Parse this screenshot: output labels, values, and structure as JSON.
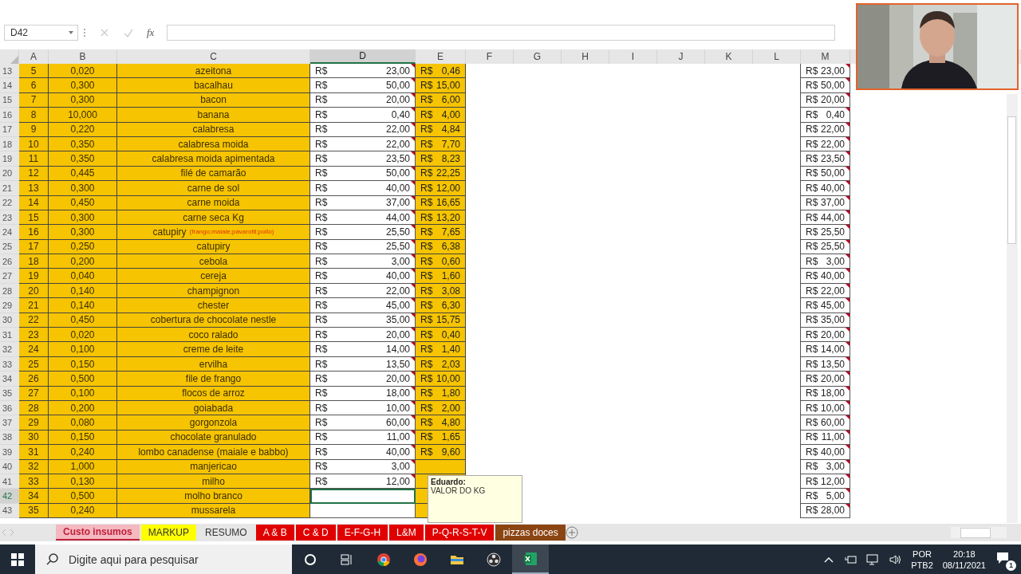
{
  "formula_bar": {
    "name_box": "D42",
    "fx": "fx"
  },
  "columns": [
    {
      "label": "A",
      "selected": false
    },
    {
      "label": "B",
      "selected": false
    },
    {
      "label": "C",
      "selected": false
    },
    {
      "label": "D",
      "selected": true
    },
    {
      "label": "E",
      "selected": false
    },
    {
      "label": "F",
      "selected": false
    },
    {
      "label": "G",
      "selected": false
    },
    {
      "label": "H",
      "selected": false
    },
    {
      "label": "I",
      "selected": false
    },
    {
      "label": "J",
      "selected": false
    },
    {
      "label": "K",
      "selected": false
    },
    {
      "label": "L",
      "selected": false
    },
    {
      "label": "M",
      "selected": false
    }
  ],
  "rows": [
    {
      "row": "13",
      "a": "5",
      "b": "0,020",
      "c": "azeitona",
      "d_cur": "R$",
      "d": "23,00",
      "e_cur": "R$",
      "e": "0,46",
      "m_cur": "R$",
      "m": "23,00",
      "selected": false
    },
    {
      "row": "14",
      "a": "6",
      "b": "0,300",
      "c": "bacalhau",
      "d_cur": "R$",
      "d": "50,00",
      "e_cur": "R$",
      "e": "15,00",
      "m_cur": "R$",
      "m": "50,00",
      "selected": false
    },
    {
      "row": "15",
      "a": "7",
      "b": "0,300",
      "c": "bacon",
      "d_cur": "R$",
      "d": "20,00",
      "e_cur": "R$",
      "e": "6,00",
      "m_cur": "R$",
      "m": "20,00",
      "selected": false
    },
    {
      "row": "16",
      "a": "8",
      "b": "10,000",
      "c": "banana",
      "d_cur": "R$",
      "d": "0,40",
      "e_cur": "R$",
      "e": "4,00",
      "m_cur": "R$",
      "m": "0,40",
      "selected": false
    },
    {
      "row": "17",
      "a": "9",
      "b": "0,220",
      "c": "calabresa",
      "d_cur": "R$",
      "d": "22,00",
      "e_cur": "R$",
      "e": "4,84",
      "m_cur": "R$",
      "m": "22,00",
      "selected": false
    },
    {
      "row": "18",
      "a": "10",
      "b": "0,350",
      "c": "calabresa moida",
      "d_cur": "R$",
      "d": "22,00",
      "e_cur": "R$",
      "e": "7,70",
      "m_cur": "R$",
      "m": "22,00",
      "selected": false
    },
    {
      "row": "19",
      "a": "11",
      "b": "0,350",
      "c": "calabresa moida apimentada",
      "d_cur": "R$",
      "d": "23,50",
      "e_cur": "R$",
      "e": "8,23",
      "m_cur": "R$",
      "m": "23,50",
      "selected": false
    },
    {
      "row": "20",
      "a": "12",
      "b": "0,445",
      "c": "filé de camarão",
      "d_cur": "R$",
      "d": "50,00",
      "e_cur": "R$",
      "e": "22,25",
      "m_cur": "R$",
      "m": "50,00",
      "selected": false
    },
    {
      "row": "21",
      "a": "13",
      "b": "0,300",
      "c": "carne de sol",
      "d_cur": "R$",
      "d": "40,00",
      "e_cur": "R$",
      "e": "12,00",
      "m_cur": "R$",
      "m": "40,00",
      "selected": false
    },
    {
      "row": "22",
      "a": "14",
      "b": "0,450",
      "c": "carne moida",
      "d_cur": "R$",
      "d": "37,00",
      "e_cur": "R$",
      "e": "16,65",
      "m_cur": "R$",
      "m": "37,00",
      "selected": false
    },
    {
      "row": "23",
      "a": "15",
      "b": "0,300",
      "c": "carne seca Kg",
      "d_cur": "R$",
      "d": "44,00",
      "e_cur": "R$",
      "e": "13,20",
      "m_cur": "R$",
      "m": "44,00",
      "selected": false
    },
    {
      "row": "24",
      "a": "16",
      "b": "0,300",
      "c": "catupiry",
      "c_note": "(frango;maiale;pavarotti;pollo)",
      "d_cur": "R$",
      "d": "25,50",
      "e_cur": "R$",
      "e": "7,65",
      "m_cur": "R$",
      "m": "25,50",
      "selected": false
    },
    {
      "row": "25",
      "a": "17",
      "b": "0,250",
      "c": "catupiry",
      "d_cur": "R$",
      "d": "25,50",
      "e_cur": "R$",
      "e": "6,38",
      "m_cur": "R$",
      "m": "25,50",
      "selected": false
    },
    {
      "row": "26",
      "a": "18",
      "b": "0,200",
      "c": "cebola",
      "d_cur": "R$",
      "d": "3,00",
      "e_cur": "R$",
      "e": "0,60",
      "m_cur": "R$",
      "m": "3,00",
      "selected": false
    },
    {
      "row": "27",
      "a": "19",
      "b": "0,040",
      "c": "cereja",
      "d_cur": "R$",
      "d": "40,00",
      "e_cur": "R$",
      "e": "1,60",
      "m_cur": "R$",
      "m": "40,00",
      "selected": false
    },
    {
      "row": "28",
      "a": "20",
      "b": "0,140",
      "c": "champignon",
      "d_cur": "R$",
      "d": "22,00",
      "e_cur": "R$",
      "e": "3,08",
      "m_cur": "R$",
      "m": "22,00",
      "selected": false
    },
    {
      "row": "29",
      "a": "21",
      "b": "0,140",
      "c": "chester",
      "d_cur": "R$",
      "d": "45,00",
      "e_cur": "R$",
      "e": "6,30",
      "m_cur": "R$",
      "m": "45,00",
      "selected": false
    },
    {
      "row": "30",
      "a": "22",
      "b": "0,450",
      "c": "cobertura de chocolate nestle",
      "d_cur": "R$",
      "d": "35,00",
      "e_cur": "R$",
      "e": "15,75",
      "m_cur": "R$",
      "m": "35,00",
      "selected": false
    },
    {
      "row": "31",
      "a": "23",
      "b": "0,020",
      "c": "coco ralado",
      "d_cur": "R$",
      "d": "20,00",
      "e_cur": "R$",
      "e": "0,40",
      "m_cur": "R$",
      "m": "20,00",
      "selected": false
    },
    {
      "row": "32",
      "a": "24",
      "b": "0,100",
      "c": "creme de leite",
      "d_cur": "R$",
      "d": "14,00",
      "e_cur": "R$",
      "e": "1,40",
      "m_cur": "R$",
      "m": "14,00",
      "selected": false
    },
    {
      "row": "33",
      "a": "25",
      "b": "0,150",
      "c": "ervilha",
      "d_cur": "R$",
      "d": "13,50",
      "e_cur": "R$",
      "e": "2,03",
      "m_cur": "R$",
      "m": "13,50",
      "selected": false
    },
    {
      "row": "34",
      "a": "26",
      "b": "0,500",
      "c": "file de frango",
      "d_cur": "R$",
      "d": "20,00",
      "e_cur": "R$",
      "e": "10,00",
      "m_cur": "R$",
      "m": "20,00",
      "selected": false
    },
    {
      "row": "35",
      "a": "27",
      "b": "0,100",
      "c": "flocos de arroz",
      "d_cur": "R$",
      "d": "18,00",
      "e_cur": "R$",
      "e": "1,80",
      "m_cur": "R$",
      "m": "18,00",
      "selected": false
    },
    {
      "row": "36",
      "a": "28",
      "b": "0,200",
      "c": "goiabada",
      "d_cur": "R$",
      "d": "10,00",
      "e_cur": "R$",
      "e": "2,00",
      "m_cur": "R$",
      "m": "10,00",
      "selected": false
    },
    {
      "row": "37",
      "a": "29",
      "b": "0,080",
      "c": "gorgonzola",
      "d_cur": "R$",
      "d": "60,00",
      "e_cur": "R$",
      "e": "4,80",
      "m_cur": "R$",
      "m": "60,00",
      "selected": false
    },
    {
      "row": "38",
      "a": "30",
      "b": "0,150",
      "c": "chocolate granulado",
      "d_cur": "R$",
      "d": "11,00",
      "e_cur": "R$",
      "e": "1,65",
      "m_cur": "R$",
      "m": "11,00",
      "selected": false
    },
    {
      "row": "39",
      "a": "31",
      "b": "0,240",
      "c": "lombo canadense (maiale e babbo)",
      "d_cur": "R$",
      "d": "40,00",
      "e_cur": "R$",
      "e": "9,60",
      "m_cur": "R$",
      "m": "40,00",
      "selected": false
    },
    {
      "row": "40",
      "a": "32",
      "b": "1,000",
      "c": "manjericao",
      "d_cur": "R$",
      "d": "3,00",
      "m_cur": "R$",
      "m": "3,00",
      "selected": false
    },
    {
      "row": "41",
      "a": "33",
      "b": "0,130",
      "c": "milho",
      "d_cur": "R$",
      "d": "12,00",
      "m_cur": "R$",
      "m": "12,00",
      "selected": false
    },
    {
      "row": "42",
      "a": "34",
      "b": "0,500",
      "c": "molho branco",
      "m_cur": "R$",
      "m": "5,00",
      "selected": true
    },
    {
      "row": "43",
      "a": "35",
      "b": "0,240",
      "c": "mussarela",
      "m_cur": "R$",
      "m": "28,00",
      "selected": false
    }
  ],
  "comment": {
    "author": "Eduardo:",
    "text": "VALOR DO KG"
  },
  "tabs": [
    {
      "label": "Custo insumos",
      "color": "#f4b8c0",
      "selected": true
    },
    {
      "label": "MARKUP",
      "color": "#ffff00",
      "selected": false
    },
    {
      "label": "RESUMO",
      "color": "#e6e6e6",
      "selected": false
    },
    {
      "label": "A & B",
      "color": "#e00000",
      "selected": false
    },
    {
      "label": "C & D",
      "color": "#e00000",
      "selected": false
    },
    {
      "label": "E-F-G-H",
      "color": "#e00000",
      "selected": false
    },
    {
      "label": "L&M",
      "color": "#e00000",
      "selected": false
    },
    {
      "label": "P-Q-R-S-T-V",
      "color": "#e00000",
      "selected": false
    },
    {
      "label": "pizzas doces",
      "color": "#8b4513",
      "selected": false
    }
  ],
  "taskbar": {
    "search_placeholder": "Digite aqui para pesquisar",
    "language": "POR",
    "layout": "PTB2",
    "time": "20:18",
    "date": "08/11/2021",
    "notifications": "1"
  }
}
